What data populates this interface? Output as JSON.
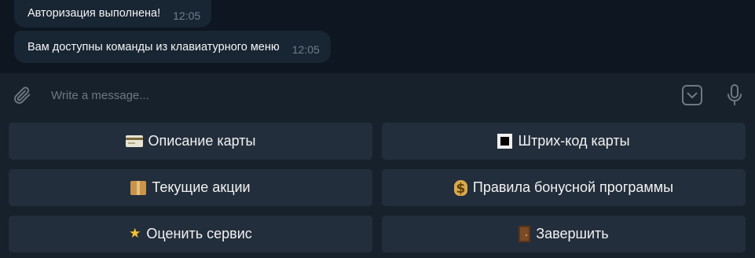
{
  "chat": {
    "messages": [
      {
        "text": "Авторизация выполнена!",
        "time": "12:05"
      },
      {
        "text": "Вам доступны команды из клавиатурного меню",
        "time": "12:05"
      }
    ]
  },
  "composer": {
    "placeholder": "Write a message...",
    "icons": {
      "attach": "paperclip-icon",
      "keyboard_toggle": "bot-keyboard-icon",
      "voice": "microphone-icon"
    }
  },
  "keyboard": {
    "buttons": [
      {
        "emoji": "credit-card",
        "label": "Описание карты"
      },
      {
        "emoji": "black-square",
        "label": "Штрих-код карты"
      },
      {
        "emoji": "package",
        "label": "Текущие акции"
      },
      {
        "emoji": "money-bag",
        "label": "Правила бонусной программы"
      },
      {
        "emoji": "star",
        "label": "Оценить сервис"
      },
      {
        "emoji": "door",
        "label": "Завершить"
      }
    ]
  },
  "colors": {
    "chat_background": "#0e1621",
    "bubble_incoming": "#182533",
    "panel_background": "#17212b",
    "keyboard_button": "#232e3c",
    "timestamp": "#6d7f8f"
  }
}
